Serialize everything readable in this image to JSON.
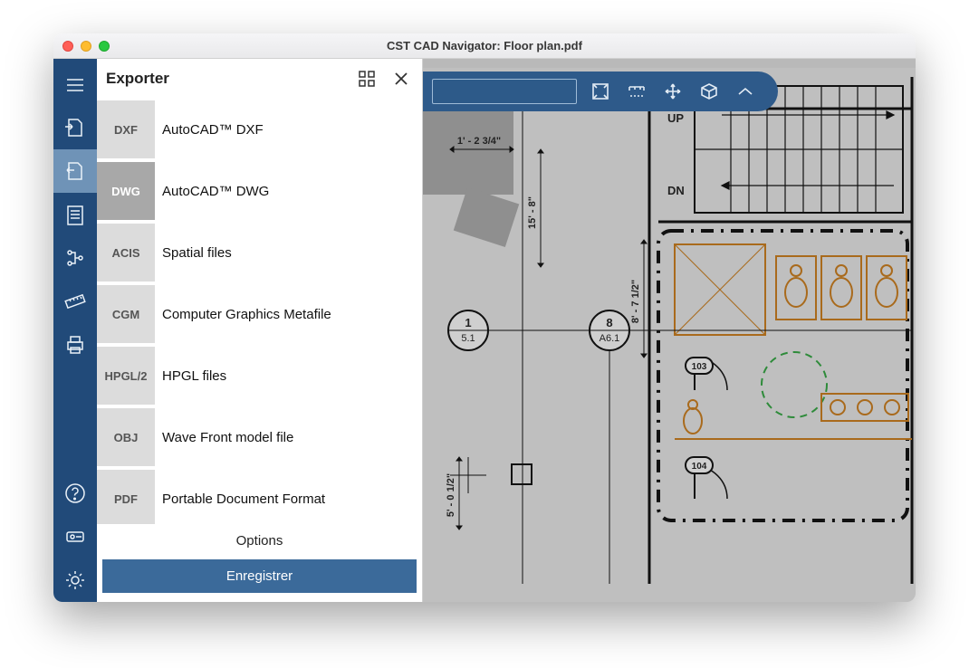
{
  "window": {
    "title": "CST CAD Navigator: Floor plan.pdf"
  },
  "export": {
    "title": "Exporter",
    "options_label": "Options",
    "save_label": "Enregistrer",
    "formats": [
      {
        "code": "DXF",
        "label": "AutoCAD™ DXF"
      },
      {
        "code": "DWG",
        "label": "AutoCAD™ DWG"
      },
      {
        "code": "ACIS",
        "label": "Spatial files"
      },
      {
        "code": "CGM",
        "label": "Computer Graphics Metafile"
      },
      {
        "code": "HPGL/2",
        "label": "HPGL files"
      },
      {
        "code": "OBJ",
        "label": "Wave Front model file"
      },
      {
        "code": "PDF",
        "label": "Portable Document Format"
      }
    ],
    "selected_index": 1
  },
  "canvas": {
    "labels": {
      "up": "UP",
      "dn": "DN",
      "dim1": "1' - 2 3/4\"",
      "dim_v1": "15' - 8\"",
      "dim_v2": "8' - 7 1/2\"",
      "dim_v3": "5' - 0 1/2\""
    },
    "callouts": [
      {
        "num": "1",
        "sub": "5.1"
      },
      {
        "num": "8",
        "sub": "A6.1"
      }
    ],
    "room_tags": [
      "103",
      "104"
    ]
  }
}
